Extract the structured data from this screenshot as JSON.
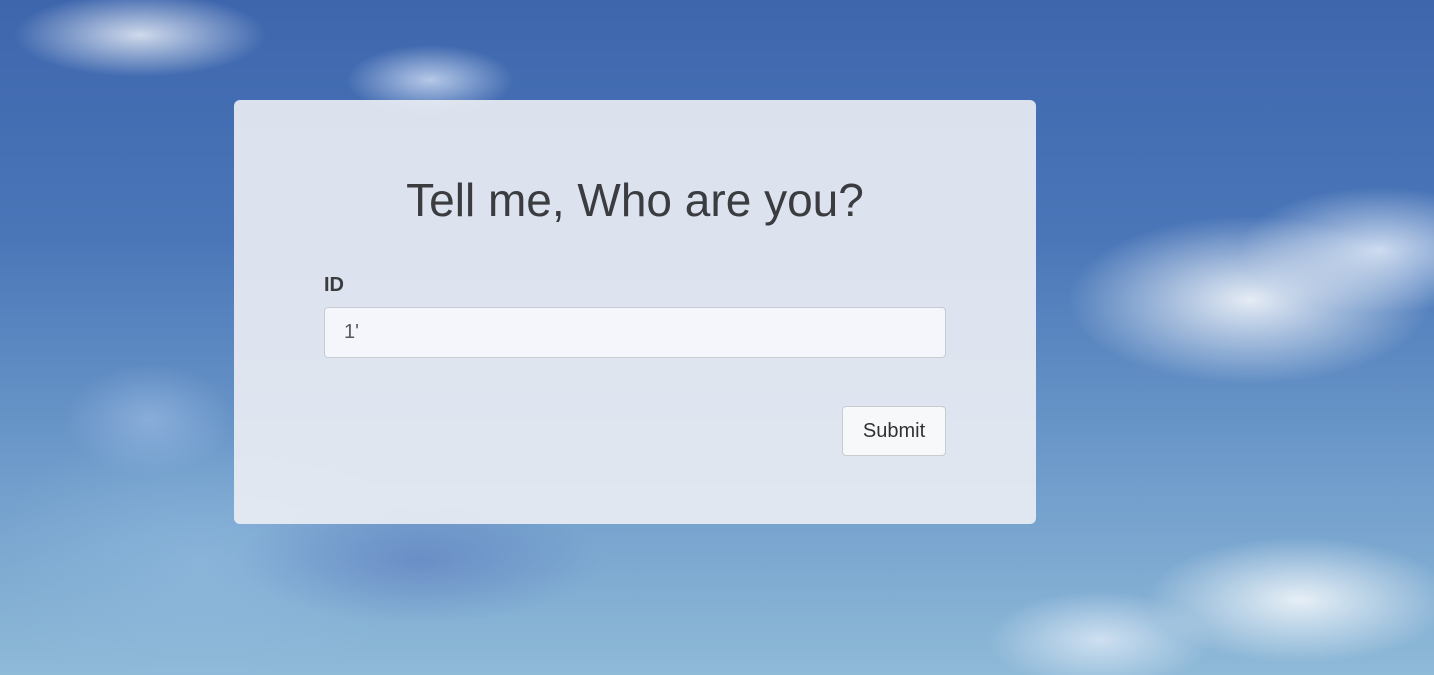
{
  "form": {
    "title": "Tell me, Who are you?",
    "id_label": "ID",
    "id_value": "1'",
    "submit_label": "Submit"
  },
  "colors": {
    "card_background": "#eceef4",
    "text": "#3a3c3f",
    "sky": "#4a76b8"
  }
}
